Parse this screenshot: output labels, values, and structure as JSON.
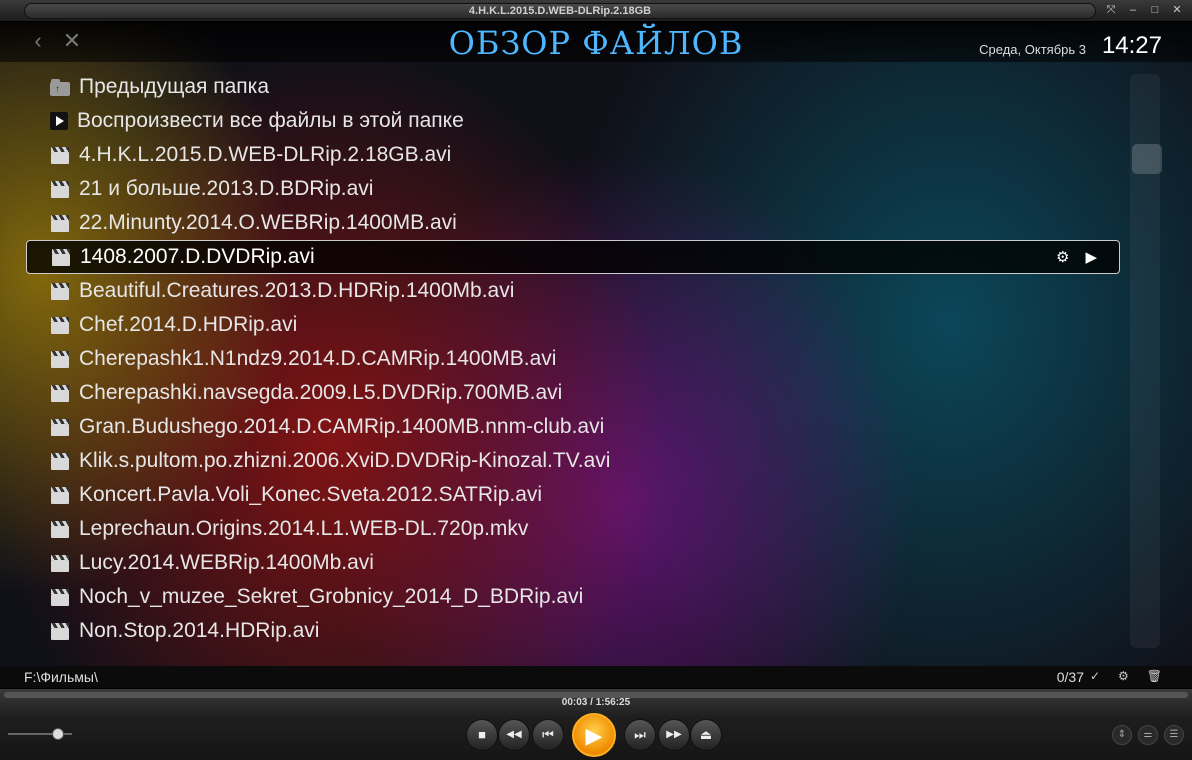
{
  "window": {
    "title": "4.H.K.L.2015.D.WEB-DLRip.2.18GB",
    "buttons": [
      "⤧",
      "–",
      "□",
      "✕"
    ]
  },
  "header": {
    "back_icon": "‹",
    "close_icon": "✕",
    "title": "ОБЗОР ФАЙЛОВ",
    "date": "Среда, Октябрь 3",
    "time": "14:27"
  },
  "file_list": {
    "parent_folder": "Предыдущая папка",
    "play_all": "Воспроизвести все файлы в этой папке",
    "files": [
      "4.H.K.L.2015.D.WEB-DLRip.2.18GB.avi",
      "21 и больше.2013.D.BDRip.avi",
      "22.Minunty.2014.O.WEBRip.1400MB.avi",
      "1408.2007.D.DVDRip.avi",
      "Beautiful.Creatures.2013.D.HDRip.1400Mb.avi",
      "Chef.2014.D.HDRip.avi",
      "Cherepashk1.N1ndz9.2014.D.CAMRip.1400MB.avi",
      "Cherepashki.navsegda.2009.L5.DVDRip.700MB.avi",
      "Gran.Budushego.2014.D.CAMRip.1400MB.nnm-club.avi",
      "Klik.s.pultom.po.zhizni.2006.XviD.DVDRip-Kinozal.TV.avi",
      "Koncert.Pavla.Voli_Konec.Sveta.2012.SATRip.avi",
      "Leprechaun.Origins.2014.L1.WEB-DL.720p.mkv",
      "Lucy.2014.WEBRip.1400Mb.avi",
      "Noch_v_muzee_Sekret_Grobnicy_2014_D_BDRip.avi",
      "Non.Stop.2014.HDRip.avi"
    ],
    "selected_index": 3,
    "selected_actions": [
      "⚙",
      "▶"
    ]
  },
  "status": {
    "path": "F:\\Фильмы\\",
    "count": "0/37",
    "icons": [
      "✓",
      "⚙",
      "🗑"
    ]
  },
  "player": {
    "time": "00:03 / 1:56:25",
    "progress": 0.0004,
    "volume": 0.75,
    "controls": [
      "■",
      "◀◀",
      "⏮",
      "▶",
      "⏭",
      "▶▶",
      "⏏"
    ],
    "right_controls": [
      "⇕",
      "⚌",
      "☰"
    ]
  }
}
